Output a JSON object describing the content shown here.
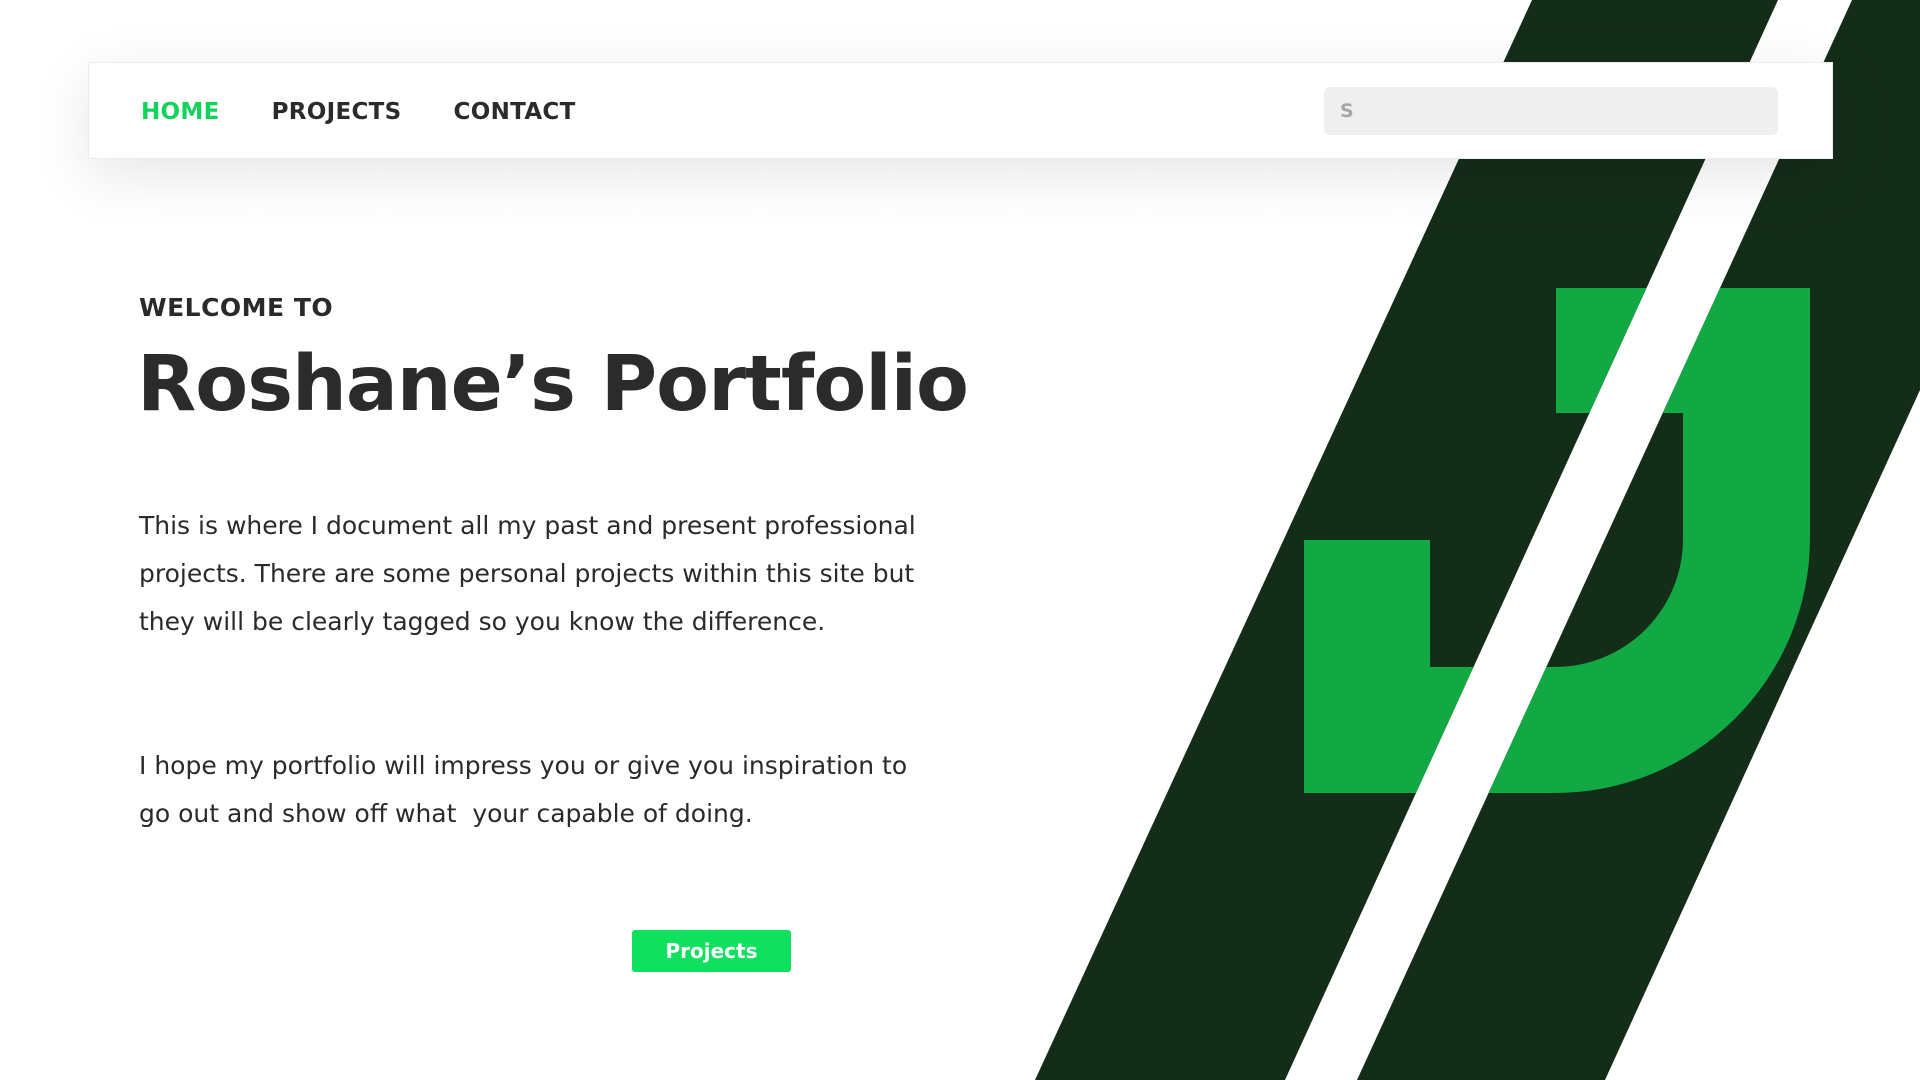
{
  "nav": {
    "items": [
      {
        "label": "HOME",
        "active": true
      },
      {
        "label": "PROJECTS",
        "active": false
      },
      {
        "label": "CONTACT",
        "active": false
      }
    ],
    "search": {
      "placeholder": "S",
      "value": ""
    }
  },
  "hero": {
    "eyebrow": "WELCOME TO",
    "title": "Roshane’s Portfolio",
    "paragraphs": [
      "This is where I document all my past and present professional projects. There are some personal projects within this site but they will be clearly tagged so you know the difference.",
      "I hope my portfolio will impress you or give you inspiration to go out and show off what  your capable of doing."
    ],
    "cta_label": "Projects"
  },
  "colors": {
    "accent": "#0fe05e",
    "active_nav": "#10d35a",
    "dark_green": "#142d19",
    "logo_green": "#12a844",
    "text": "#2a2a2a"
  },
  "icons": [
    "logo-j-mark"
  ]
}
